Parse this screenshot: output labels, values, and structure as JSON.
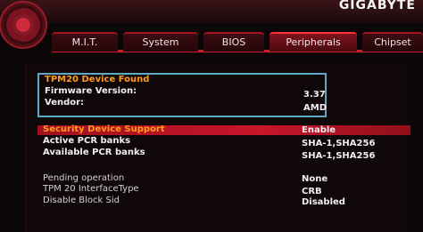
{
  "brand": "GIGABYTE",
  "tabs": [
    {
      "label": "M.I.T.",
      "active": false
    },
    {
      "label": "System",
      "active": false
    },
    {
      "label": "BIOS",
      "active": false
    },
    {
      "label": "Peripherals",
      "active": true
    },
    {
      "label": "Chipset",
      "active": false
    }
  ],
  "info": {
    "title": "TPM20 Device Found",
    "firmware_label": "Firmware Version:",
    "firmware_value": "3.37",
    "vendor_label": "Vendor:",
    "vendor_value": "AMD"
  },
  "settings": [
    {
      "label": "Security Device Support",
      "value": "Enable",
      "selected": true
    },
    {
      "label": "Active PCR banks",
      "value": "SHA-1,SHA256"
    },
    {
      "label": "Available PCR banks",
      "value": "SHA-1,SHA256"
    },
    {
      "label": "Pending operation",
      "value": "None"
    },
    {
      "label": "TPM 20 InterfaceType",
      "value": "CRB"
    },
    {
      "label": "Disable Block Sid",
      "value": "Disabled"
    }
  ],
  "colors": {
    "accent": "#c8152a",
    "highlight_text": "#ff9c1c",
    "info_border": "#5fa9c8"
  }
}
